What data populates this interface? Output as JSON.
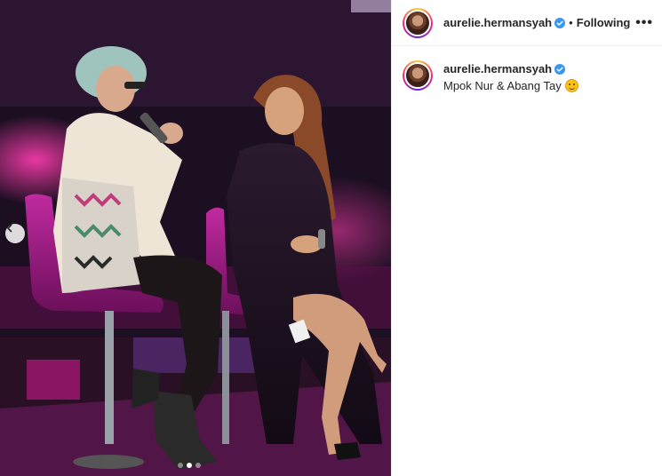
{
  "post": {
    "username": "aurelie.hermansyah",
    "follow_status": "Following",
    "separator": "•",
    "more_label": "•••",
    "caption": "Mpok Nur & Abang Tay",
    "caption_emoji": "smiling-face-icon",
    "carousel": {
      "total_slides": 3,
      "active_index": 1
    }
  },
  "colors": {
    "verified_badge": "#3897f0",
    "text": "#262626",
    "border": "#efefef",
    "stage_magenta": "#b2187f"
  }
}
